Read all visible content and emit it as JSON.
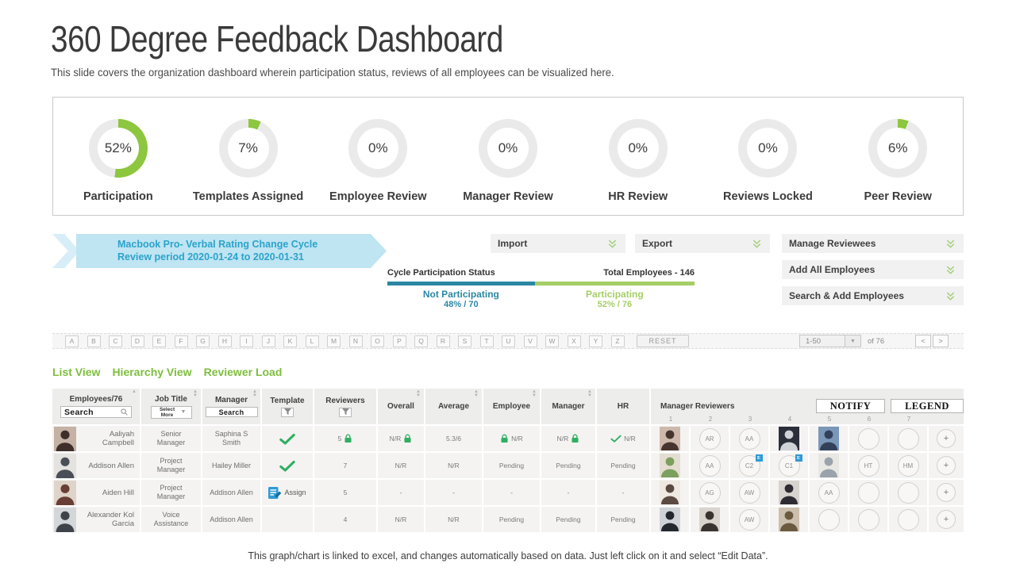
{
  "title": "360 Degree Feedback Dashboard",
  "subtitle": "This slide covers the organization dashboard wherein participation status, reviews of all employees can be visualized here.",
  "colors": {
    "green": "#8DC63F",
    "green_dark": "#2FAF62",
    "teal": "#2B87A3",
    "light_green": "#A5CE66",
    "track": "#EAEAEA",
    "banner_bg": "#BFE4F2",
    "banner_text": "#2BA3CA",
    "tab_green": "#7DBE3D",
    "assign_blue": "#2E9BD6"
  },
  "kpis": [
    {
      "label": "Participation",
      "pct": "52%",
      "value": 52
    },
    {
      "label": "Templates Assigned",
      "pct": "7%",
      "value": 7
    },
    {
      "label": "Employee Review",
      "pct": "0%",
      "value": 0
    },
    {
      "label": "Manager Review",
      "pct": "0%",
      "value": 0
    },
    {
      "label": "HR Review",
      "pct": "0%",
      "value": 0
    },
    {
      "label": "Reviews Locked",
      "pct": "0%",
      "value": 0
    },
    {
      "label": "Peer Review",
      "pct": "6%",
      "value": 6
    }
  ],
  "banner": {
    "line1": "Macbook Pro- Verbal Rating Change Cycle",
    "line2": "Review period 2020-01-24 to 2020-01-31"
  },
  "toolbar": {
    "import_label": "Import",
    "export_label": "Export",
    "right_actions": [
      "Manage Reviewees",
      "Add All Employees",
      "Search & Add Employees"
    ]
  },
  "participation": {
    "title": "Cycle Participation Status",
    "total": "Total Employees - 146",
    "segments": [
      {
        "label": "Not Participating",
        "value": "48% / 70",
        "pct": 48
      },
      {
        "label": "Participating",
        "value": "52% / 76",
        "pct": 52
      }
    ]
  },
  "filter_bar": {
    "letters": [
      "A",
      "B",
      "C",
      "D",
      "E",
      "F",
      "G",
      "H",
      "I",
      "J",
      "K",
      "L",
      "M",
      "N",
      "O",
      "P",
      "Q",
      "R",
      "S",
      "T",
      "U",
      "V",
      "W",
      "X",
      "Y",
      "Z"
    ],
    "reset": "RESET",
    "page_range": "1-50",
    "of_label": "of 76",
    "prev": "<",
    "next": ">"
  },
  "tabs": [
    {
      "label": "List View"
    },
    {
      "label": "Hierarchy View"
    },
    {
      "label": "Reviewer Load"
    }
  ],
  "table": {
    "headers": {
      "employees": "Employees/76",
      "employees_search": "Search",
      "job": "Job Title",
      "job_select": "Select More",
      "manager": "Manager",
      "manager_search": "Search",
      "template": "Template",
      "reviewers": "Reviewers",
      "overall": "Overall",
      "average": "Average",
      "employee": "Employee",
      "manager_review": "Manager",
      "hr": "HR",
      "manager_reviewers": "Manager Reviewers"
    },
    "notify": "NOTIFY",
    "legend": "LEGEND",
    "reviewer_cols": [
      "1",
      "2",
      "3",
      "4",
      "5",
      "6",
      "7"
    ],
    "rows": [
      {
        "name": "Aaliyah Campbell",
        "job": "Senior Manager",
        "manager": "Saphina S Smith",
        "photo": {
          "bg": "#c4b2a5",
          "p": "#3f2f2b"
        },
        "template": {
          "type": "check"
        },
        "reviewers": {
          "count": "5",
          "lock": true
        },
        "overall": {
          "text": "N/R",
          "lock": "after"
        },
        "average": {
          "text": "5.3/6"
        },
        "employee": {
          "text": "N/R",
          "lock": "before"
        },
        "manager_review": {
          "text": "N/R",
          "lock": "after"
        },
        "hr": {
          "text": "N/R",
          "check": true
        },
        "panel": [
          {
            "type": "photo",
            "bg": "#cdb9ac",
            "p": "#46342e"
          },
          {
            "type": "init",
            "label": "AR"
          },
          {
            "type": "init",
            "label": "AA"
          },
          {
            "type": "photo",
            "bg": "#2b2f3a",
            "p": "#cfd3d8"
          },
          {
            "type": "photo",
            "bg": "#7a97b8",
            "p": "#32405a"
          },
          {
            "type": "empty"
          },
          {
            "type": "empty"
          },
          {
            "type": "plus",
            "label": "+"
          }
        ]
      },
      {
        "name": "Addison Allen",
        "job": "Project Manager",
        "manager": "Hailey Miller",
        "photo": {
          "bg": "#e5e3df",
          "p": "#4a4f57"
        },
        "template": {
          "type": "check"
        },
        "reviewers": {
          "count": "7"
        },
        "overall": {
          "text": "N/R"
        },
        "average": {
          "text": "N/R"
        },
        "employee": {
          "text": "Pending"
        },
        "manager_review": {
          "text": "Pending"
        },
        "hr": {
          "text": "Pending"
        },
        "panel": [
          {
            "type": "photo",
            "bg": "#e3ddd2",
            "p": "#7ba05e"
          },
          {
            "type": "init",
            "label": "AA"
          },
          {
            "type": "init",
            "label": "C2",
            "badge": "E"
          },
          {
            "type": "init",
            "label": "C1",
            "badge": "E"
          },
          {
            "type": "photo",
            "bg": "#e9e7e3",
            "p": "#9aa3ab"
          },
          {
            "type": "init",
            "label": "HT"
          },
          {
            "type": "init",
            "label": "HM"
          },
          {
            "type": "plus",
            "label": "+"
          }
        ]
      },
      {
        "name": "Aiden Hill",
        "job": "Project Manager",
        "manager": "Addison Allen",
        "photo": {
          "bg": "#ded4ca",
          "p": "#693f35"
        },
        "template": {
          "type": "assign",
          "label": "Assign"
        },
        "reviewers": {
          "count": "5"
        },
        "overall": {
          "text": "-"
        },
        "average": {
          "text": "-"
        },
        "employee": {
          "text": "-"
        },
        "manager_review": {
          "text": "-"
        },
        "hr": {
          "text": "-"
        },
        "panel": [
          {
            "type": "photo",
            "bg": "#efe9e2",
            "p": "#5b4a42"
          },
          {
            "type": "init",
            "label": "AG"
          },
          {
            "type": "init",
            "label": "AW"
          },
          {
            "type": "photo",
            "bg": "#d7d3cf",
            "p": "#2e2b33"
          },
          {
            "type": "init",
            "label": "AA"
          },
          {
            "type": "empty"
          },
          {
            "type": "empty"
          },
          {
            "type": "plus",
            "label": "+"
          }
        ]
      },
      {
        "name": "Alexander Kol Garcia",
        "job": "Voice Assistance",
        "manager": "Addison Allen",
        "photo": {
          "bg": "#d4d7da",
          "p": "#3f444b"
        },
        "template": {
          "type": "none"
        },
        "reviewers": {
          "count": "4"
        },
        "overall": {
          "text": "N/R"
        },
        "average": {
          "text": "N/R"
        },
        "employee": {
          "text": "Pending"
        },
        "manager_review": {
          "text": "Pending"
        },
        "hr": {
          "text": "Pending"
        },
        "panel": [
          {
            "type": "photo",
            "bg": "#cfd3d8",
            "p": "#23272e"
          },
          {
            "type": "photo",
            "bg": "#d9d4cd",
            "p": "#3a3430"
          },
          {
            "type": "init",
            "label": "AW"
          },
          {
            "type": "photo",
            "bg": "#cbbfae",
            "p": "#6b5a3f"
          },
          {
            "type": "empty"
          },
          {
            "type": "empty"
          },
          {
            "type": "empty"
          },
          {
            "type": "plus",
            "label": "+"
          }
        ]
      }
    ]
  },
  "footer": "This graph/chart is linked to excel, and changes automatically based on data. Just left click on it and select “Edit Data”."
}
